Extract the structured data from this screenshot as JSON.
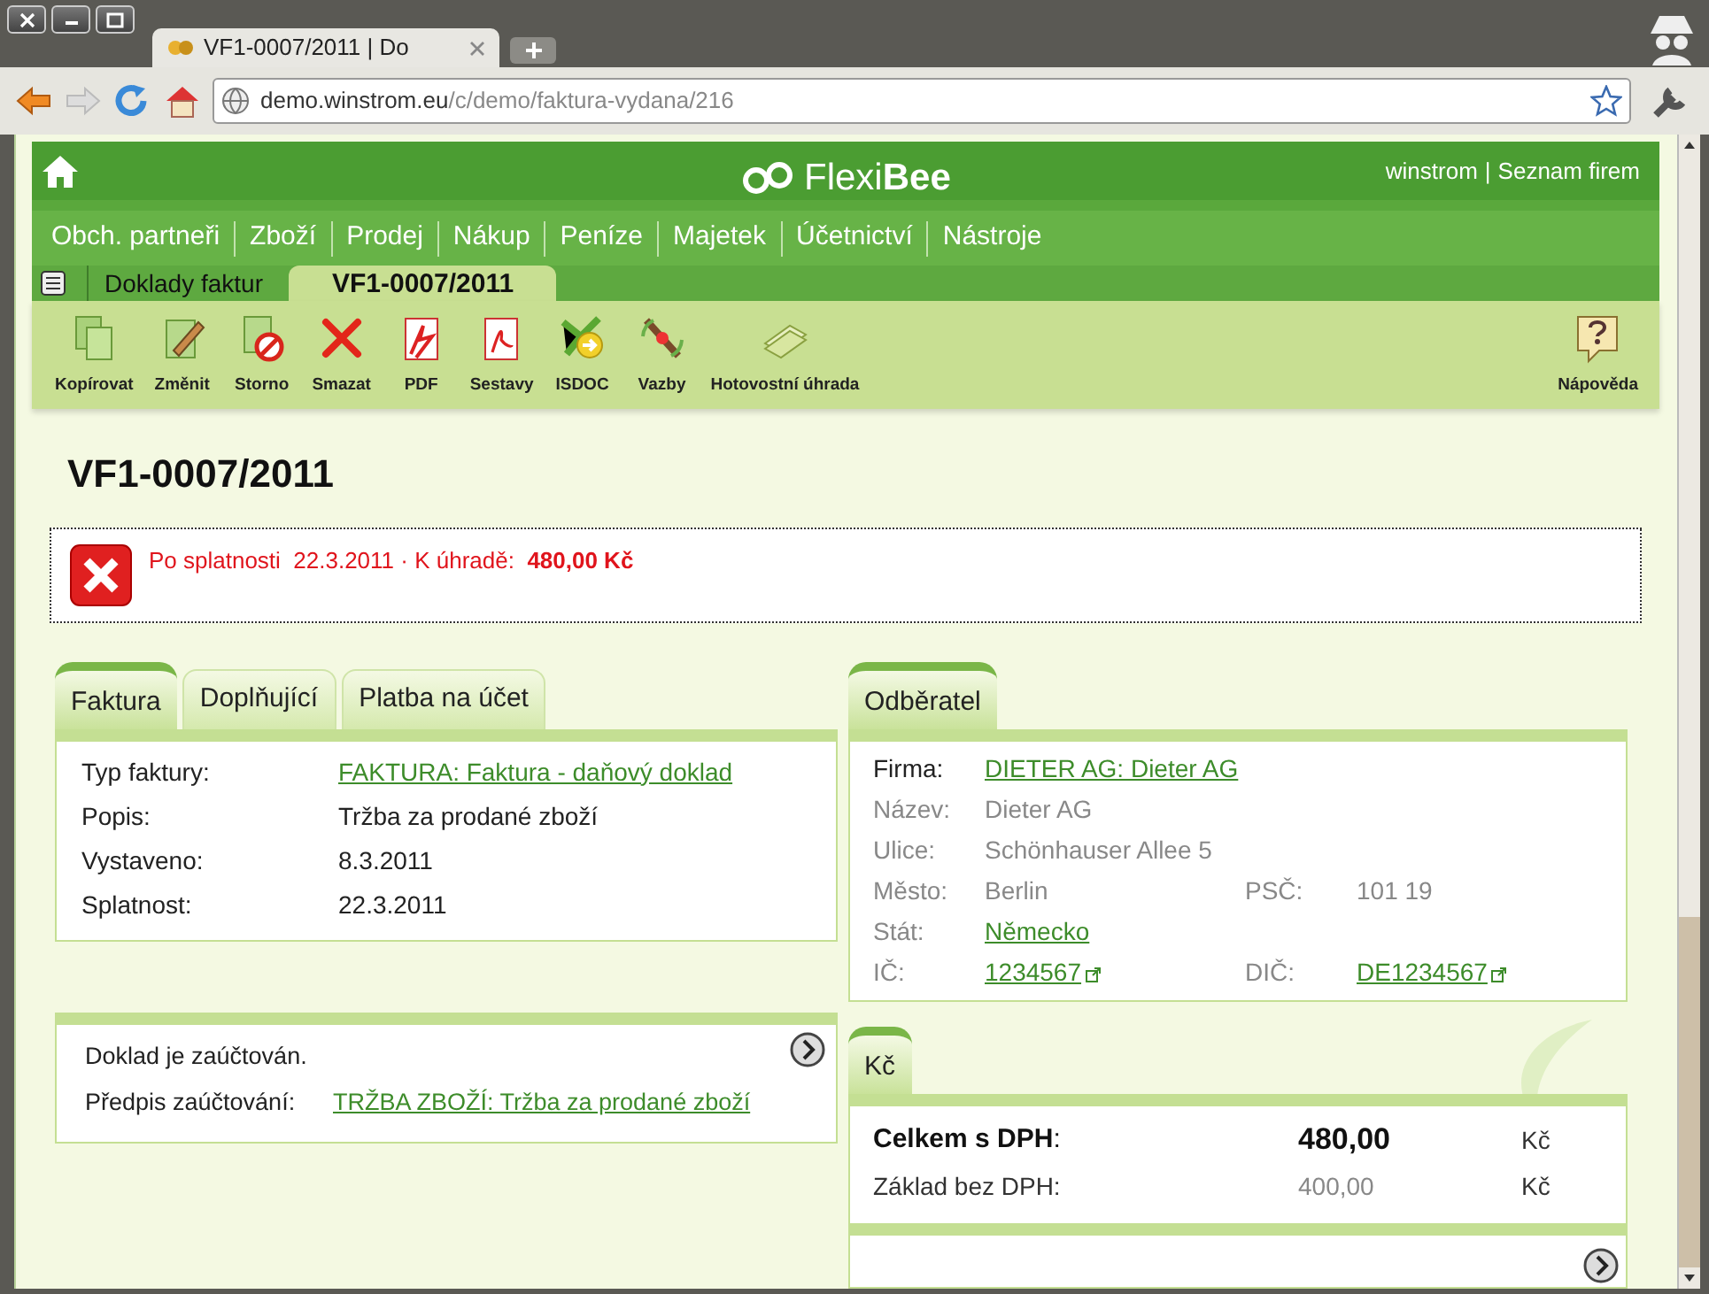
{
  "browser": {
    "tab_title": "VF1-0007/2011 | Do",
    "url_host": "demo.winstrom.eu",
    "url_path": "/c/demo/faktura-vydana/216"
  },
  "header": {
    "logo_light": "Flexi",
    "logo_bold": "Bee",
    "user": "winstrom",
    "separator": "|",
    "companies": "Seznam firem"
  },
  "nav": [
    "Obch. partneři",
    "Zboží",
    "Prodej",
    "Nákup",
    "Peníze",
    "Majetek",
    "Účetnictví",
    "Nástroje"
  ],
  "breadcrumb": [
    {
      "label": "Doklady faktur",
      "selected": false
    },
    {
      "label": "VF1-0007/2011",
      "selected": true
    }
  ],
  "toolbar": [
    {
      "label": "Kopírovat",
      "kind": "copy"
    },
    {
      "label": "Změnit",
      "kind": "edit"
    },
    {
      "label": "Storno",
      "kind": "storno"
    },
    {
      "label": "Smazat",
      "kind": "delete"
    },
    {
      "label": "PDF",
      "kind": "pdf"
    },
    {
      "label": "Sestavy",
      "kind": "reports"
    },
    {
      "label": "ISDOC",
      "kind": "isdoc"
    },
    {
      "label": "Vazby",
      "kind": "links"
    },
    {
      "label": "Hotovostní úhrada",
      "kind": "cash"
    }
  ],
  "help": "Nápověda",
  "title": "VF1-0007/2011",
  "alert": "Po splatnosti  22.3.2011 · K úhradě:  **480,00 Kč**",
  "invoice_tabs": [
    {
      "label": "Faktura",
      "selected": true
    },
    {
      "label": "Doplňující",
      "selected": false
    },
    {
      "label": "Platba na účet",
      "selected": false
    }
  ],
  "invoice_fields": [
    {
      "label": "Typ faktury:",
      "value": "FAKTURA: Faktura - daňový doklad",
      "kind": "link"
    },
    {
      "label": "Popis:",
      "value": "Tržba za prodané zboží",
      "kind": "text"
    },
    {
      "label": "Vystaveno:",
      "value": "8.3.2011",
      "kind": "text"
    },
    {
      "label": "Splatnost:",
      "value": "22.3.2011",
      "kind": "text"
    }
  ],
  "customer_tabs": [
    {
      "label": "Odběratel",
      "selected": true
    }
  ],
  "customer_rows": [
    [
      {
        "label": "Firma:",
        "value": "DIETER AG: Dieter AG",
        "kind": "link",
        "muted": false
      }
    ],
    [
      {
        "label": "Název:",
        "value": "Dieter AG",
        "kind": "text",
        "muted": true
      }
    ],
    [
      {
        "label": "Ulice:",
        "value": "Schönhauser Allee 5",
        "kind": "text",
        "muted": true
      }
    ],
    [
      {
        "label": "Město:",
        "value": "Berlin",
        "kind": "text",
        "muted": true
      },
      {
        "label": "PSČ:",
        "value": "101 19",
        "kind": "text",
        "muted": true
      }
    ],
    [
      {
        "label": "Stát:",
        "value": "Německo",
        "kind": "link",
        "muted": true
      }
    ],
    [
      {
        "label": "IČ:",
        "value": "1234567",
        "kind": "external",
        "muted": true
      },
      {
        "label": "DIČ:",
        "value": "DE1234567",
        "kind": "external",
        "muted": true
      }
    ]
  ],
  "posting": {
    "status": "Doklad je zaúčtován.",
    "label": "Předpis zaúčtování:",
    "value": "TRŽBA ZBOŽÍ: Tržba za prodané zboží"
  },
  "currency_tabs": [
    {
      "label": "Kč",
      "selected": true
    }
  ],
  "totals": [
    {
      "label": "**Celkem s DPH**:",
      "amount": "480,00",
      "currency": "Kč",
      "kind": "total"
    },
    {
      "label": "Základ bez DPH:",
      "amount": "400,00",
      "currency": "Kč",
      "kind": "base"
    }
  ]
}
